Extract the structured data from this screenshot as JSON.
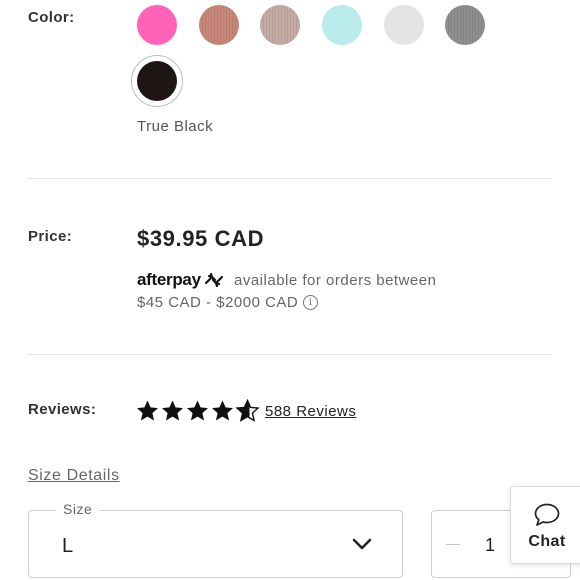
{
  "color": {
    "label": "Color:",
    "swatches": [
      {
        "name": "pink",
        "hex": "#ff63b8"
      },
      {
        "name": "rose-brown",
        "hex": "#c9877a"
      },
      {
        "name": "taupe",
        "hex": "#c4aca4"
      },
      {
        "name": "aqua",
        "hex": "#b9eaec"
      },
      {
        "name": "light-grey",
        "hex": "#e4e4e4"
      },
      {
        "name": "heather-grey",
        "hex": "#8f8f8f"
      },
      {
        "name": "true-black",
        "hex": "#1f1616",
        "selected": true
      }
    ],
    "selected_name": "True Black"
  },
  "price": {
    "label": "Price:",
    "value": "$39.95 CAD",
    "afterpay_logo_text": "afterpay",
    "afterpay_text": "available for orders between",
    "afterpay_range": "$45 CAD - $2000 CAD",
    "info_glyph": "i"
  },
  "reviews": {
    "label": "Reviews:",
    "rating": 4.5,
    "max_rating": 5,
    "link_text": "588 Reviews"
  },
  "size_details_link": "Size Details",
  "size": {
    "legend": "Size",
    "value": "L"
  },
  "quantity": {
    "value": "1"
  },
  "chat": {
    "label": "Chat"
  }
}
